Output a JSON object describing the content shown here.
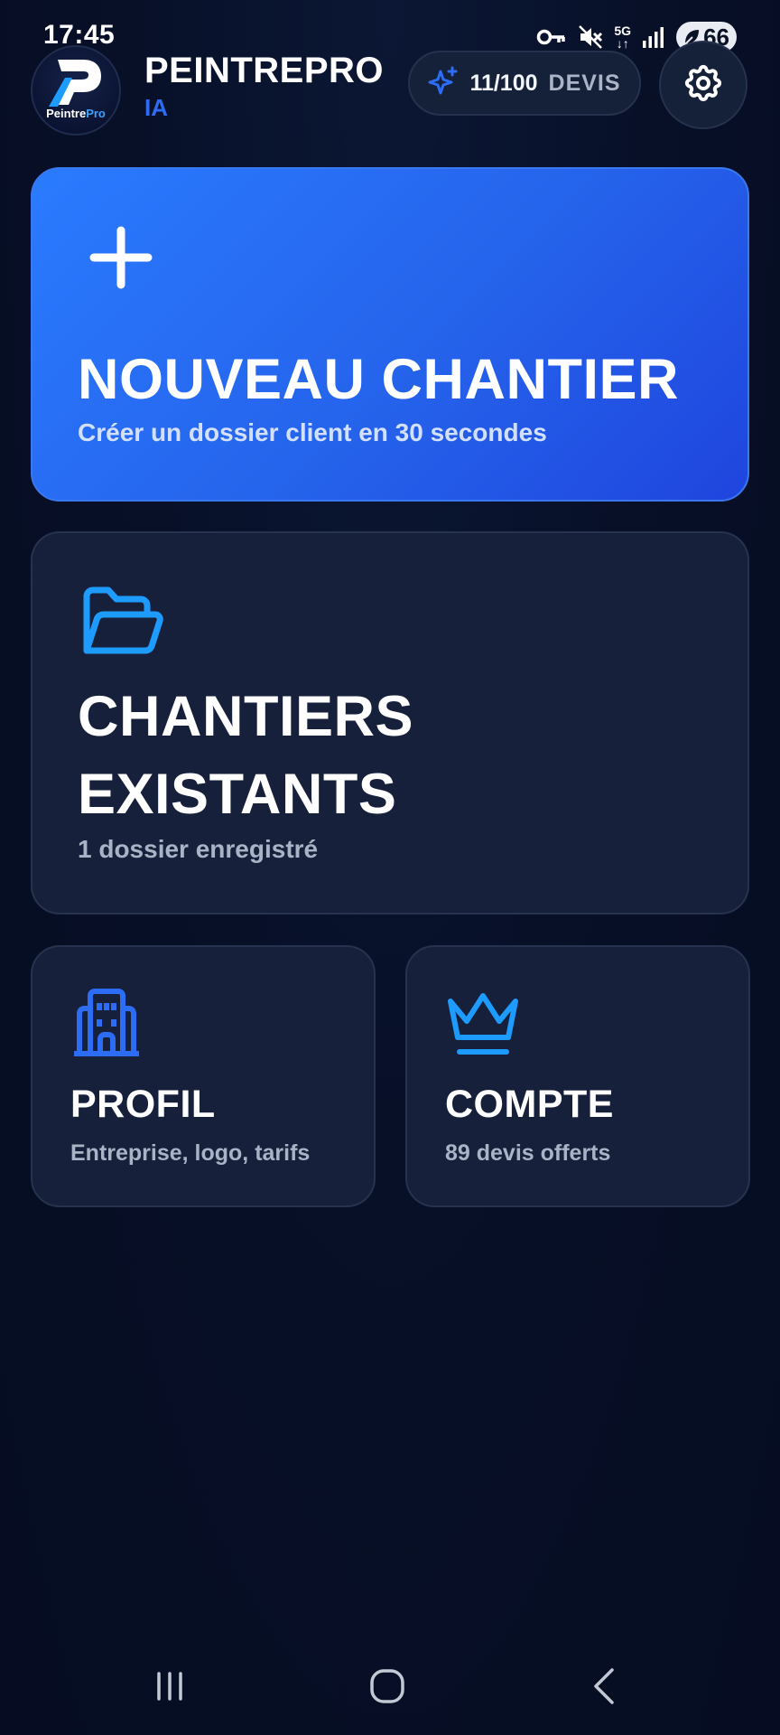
{
  "status_bar": {
    "time": "17:45",
    "network": [
      "5G",
      "↓↑"
    ],
    "battery": "66",
    "icons": [
      "vpn-key-icon",
      "mute-icon",
      "network-5g-icon",
      "signal-icon",
      "battery-icon"
    ]
  },
  "header": {
    "logo": {
      "word_main": "Peintre",
      "word_accent": "Pro",
      "tagline": "IA",
      "icon": "logo-icon"
    },
    "brand_name": "PEINTREPRO",
    "brand_sub": "IA",
    "quota": {
      "icon": "sparkle-icon",
      "count": "11/100",
      "label": "DEVIS"
    },
    "settings_icon": "gear-icon"
  },
  "cards": {
    "new_site": {
      "icon": "plus-icon",
      "title": "NOUVEAU CHANTIER",
      "subtitle": "Créer un dossier client en 30 secondes"
    },
    "existing_sites": {
      "icon": "folder-open-icon",
      "title": "CHANTIERS EXISTANTS",
      "subtitle": "1 dossier enregistré"
    },
    "profile": {
      "icon": "building-icon",
      "title": "PROFIL",
      "subtitle": "Entreprise, logo, tarifs"
    },
    "account": {
      "icon": "crown-icon",
      "title": "COMPTE",
      "subtitle": "89 devis offerts"
    }
  },
  "nav_bar": {
    "icons": [
      "recent-apps-icon",
      "home-icon",
      "back-icon"
    ]
  },
  "colors": {
    "background": "#070f26",
    "card": "#16203a",
    "card_border": "#27324e",
    "primary": "#2563eb",
    "primary_light": "#2a7bff",
    "accent_blue": "#2d6df6",
    "icon_blue": "#1e9bff",
    "muted_text": "#a9b3c6"
  }
}
